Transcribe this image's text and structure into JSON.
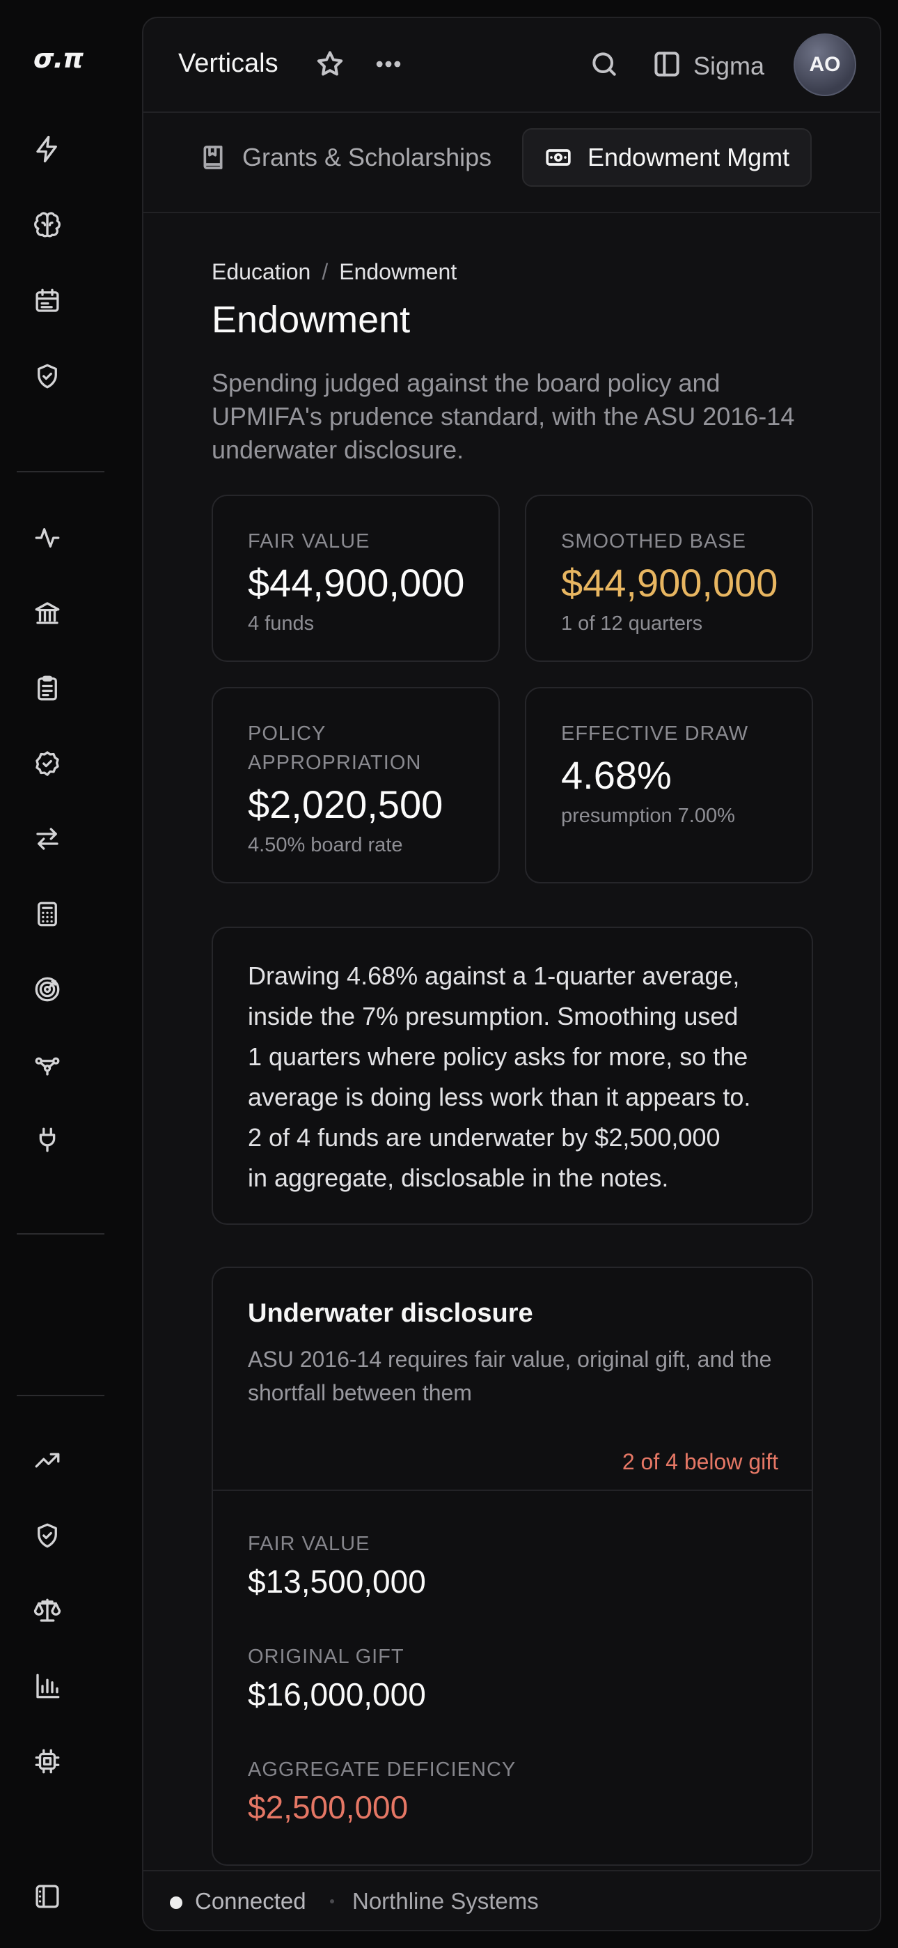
{
  "brand": {
    "logo_text": "σ.π"
  },
  "topbar": {
    "title": "Verticals",
    "workspace": "Sigma",
    "avatar_initials": "AO"
  },
  "tabs": [
    {
      "label": "Grants & Scholarships",
      "icon": "book-icon",
      "active": false
    },
    {
      "label": "Endowment Mgmt",
      "icon": "banknote-icon",
      "active": true
    }
  ],
  "breadcrumb": {
    "parent": "Education",
    "separator": "/",
    "current": "Endowment"
  },
  "page": {
    "title": "Endowment",
    "subtitle": "Spending judged against the board policy and UPMIFA's prudence standard, with the ASU 2016-14 underwater disclosure."
  },
  "kpis": {
    "fair_value": {
      "label": "FAIR VALUE",
      "value": "$44,900,000",
      "sub": "4 funds"
    },
    "smoothed_base": {
      "label": "SMOOTHED BASE",
      "value": "$44,900,000",
      "sub": "1 of 12 quarters"
    },
    "policy_appropriation": {
      "label_line1": "POLICY",
      "label_line2": "APPROPRIATION",
      "value": "$2,020,500",
      "sub": "4.50% board rate"
    },
    "effective_draw": {
      "label": "EFFECTIVE DRAW",
      "value": "4.68%",
      "sub": "presumption 7.00%"
    }
  },
  "narrative": {
    "lines": [
      "Drawing 4.68% against a 1-quarter average,",
      "inside the 7% presumption. Smoothing used",
      "1 quarters where policy asks for more, so the",
      "average is doing less work than it appears to.",
      "2 of 4 funds are underwater by $2,500,000",
      "in aggregate, disclosable in the notes."
    ]
  },
  "underwater": {
    "title": "Underwater disclosure",
    "description": "ASU 2016-14 requires fair value, original gift, and the shortfall between them",
    "badge": "2 of 4 below gift",
    "fair_value": {
      "label": "FAIR VALUE",
      "value": "$13,500,000"
    },
    "original_gift": {
      "label": "ORIGINAL GIFT",
      "value": "$16,000,000"
    },
    "aggregate_deficiency": {
      "label": "AGGREGATE DEFICIENCY",
      "value": "$2,500,000"
    }
  },
  "footer": {
    "status": "Connected",
    "org": "Northline Systems"
  },
  "colors": {
    "accent_gold": "#e8b661",
    "alert_red": "#e57765",
    "background": "#0a0a0b",
    "panel": "#111113"
  }
}
